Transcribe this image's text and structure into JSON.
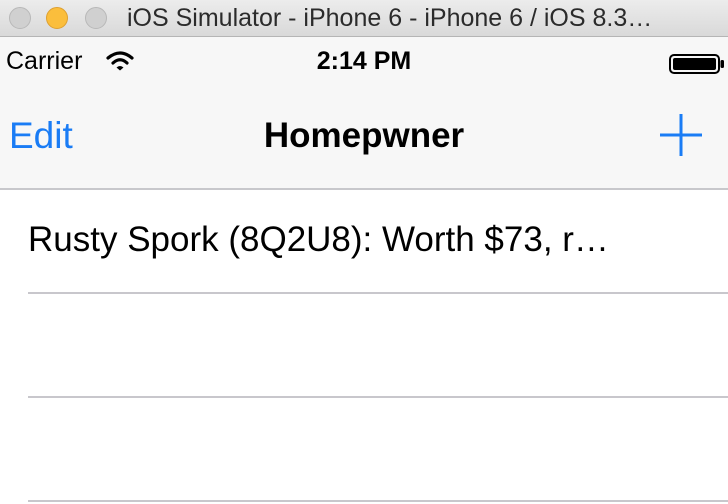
{
  "window": {
    "title": "iOS Simulator - iPhone 6 - iPhone 6 / iOS 8.3…"
  },
  "status_bar": {
    "carrier": "Carrier",
    "time": "2:14 PM"
  },
  "nav_bar": {
    "edit_label": "Edit",
    "title": "Homepwner",
    "add_icon": "plus-icon"
  },
  "table": {
    "rows": [
      {
        "label": "Rusty Spork (8Q2U8): Worth $73, r…"
      },
      {
        "label": ""
      },
      {
        "label": ""
      }
    ]
  },
  "colors": {
    "tint": "#1a7cf5",
    "bar_background": "#f7f7f7",
    "separator": "#c8c7cc"
  }
}
